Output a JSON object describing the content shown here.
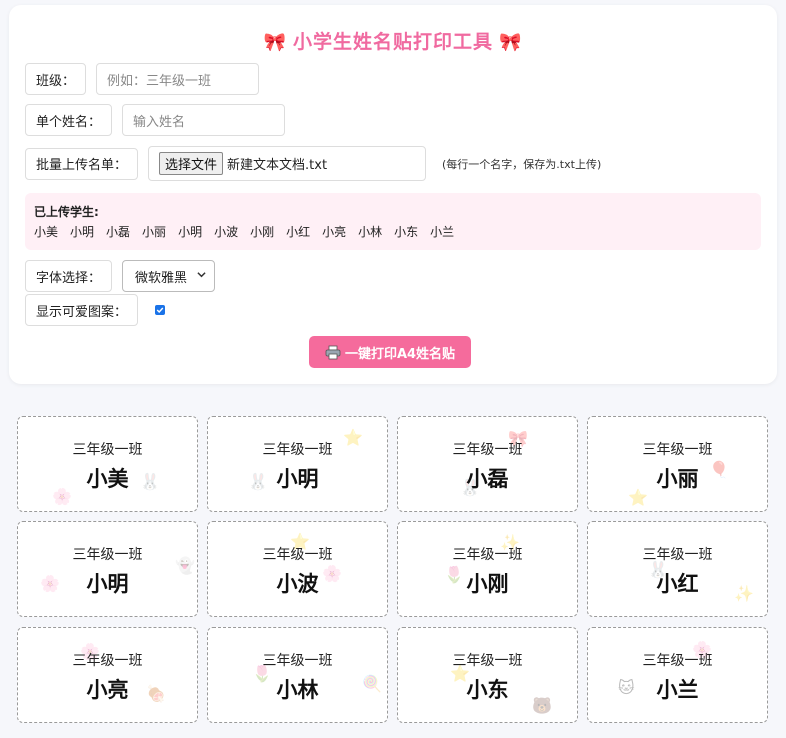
{
  "header": {
    "title": "小学生姓名贴打印工具",
    "bow": "🎀"
  },
  "form": {
    "class_label": "班级：",
    "class_placeholder": "例如：三年级一班",
    "single_name_label": "单个姓名：",
    "single_name_placeholder": "输入姓名",
    "batch_label": "批量上传名单：",
    "file_button": "选择文件",
    "file_name": "新建文本文档.txt",
    "batch_hint": "(每行一个名字，保存为.txt上传)",
    "font_label": "字体选择：",
    "font_value": "微软雅黑",
    "pattern_label": "显示可爱图案：",
    "pattern_checked": true
  },
  "uploaded": {
    "heading": "已上传学生:",
    "names": [
      "小美",
      "小明",
      "小磊",
      "小丽",
      "小明",
      "小波",
      "小刚",
      "小红",
      "小亮",
      "小林",
      "小东",
      "小兰"
    ]
  },
  "print_button": "一键打印A4姓名贴",
  "labels": [
    {
      "class": "三年级一班",
      "name": "小美",
      "decos": [
        "🐰",
        "🌸"
      ]
    },
    {
      "class": "三年级一班",
      "name": "小明",
      "decos": [
        "⭐",
        "🐰"
      ]
    },
    {
      "class": "三年级一班",
      "name": "小磊",
      "decos": [
        "🎀",
        "🐰"
      ]
    },
    {
      "class": "三年级一班",
      "name": "小丽",
      "decos": [
        "🎈",
        "⭐"
      ]
    },
    {
      "class": "三年级一班",
      "name": "小明",
      "decos": [
        "🌸",
        "👻"
      ]
    },
    {
      "class": "三年级一班",
      "name": "小波",
      "decos": [
        "⭐",
        "🌸"
      ]
    },
    {
      "class": "三年级一班",
      "name": "小刚",
      "decos": [
        "✨",
        "🌷"
      ]
    },
    {
      "class": "三年级一班",
      "name": "小红",
      "decos": [
        "🐰",
        "✨"
      ]
    },
    {
      "class": "三年级一班",
      "name": "小亮",
      "decos": [
        "🌸",
        "🍖"
      ]
    },
    {
      "class": "三年级一班",
      "name": "小林",
      "decos": [
        "🍭",
        "🌷"
      ]
    },
    {
      "class": "三年级一班",
      "name": "小东",
      "decos": [
        "⭐",
        "🐻"
      ]
    },
    {
      "class": "三年级一班",
      "name": "小兰",
      "decos": [
        "🐱",
        "🌸"
      ]
    }
  ],
  "colors": {
    "accent": "#f06aa0",
    "button": "#f56b9c",
    "uploaded_bg": "#fff0f6"
  }
}
